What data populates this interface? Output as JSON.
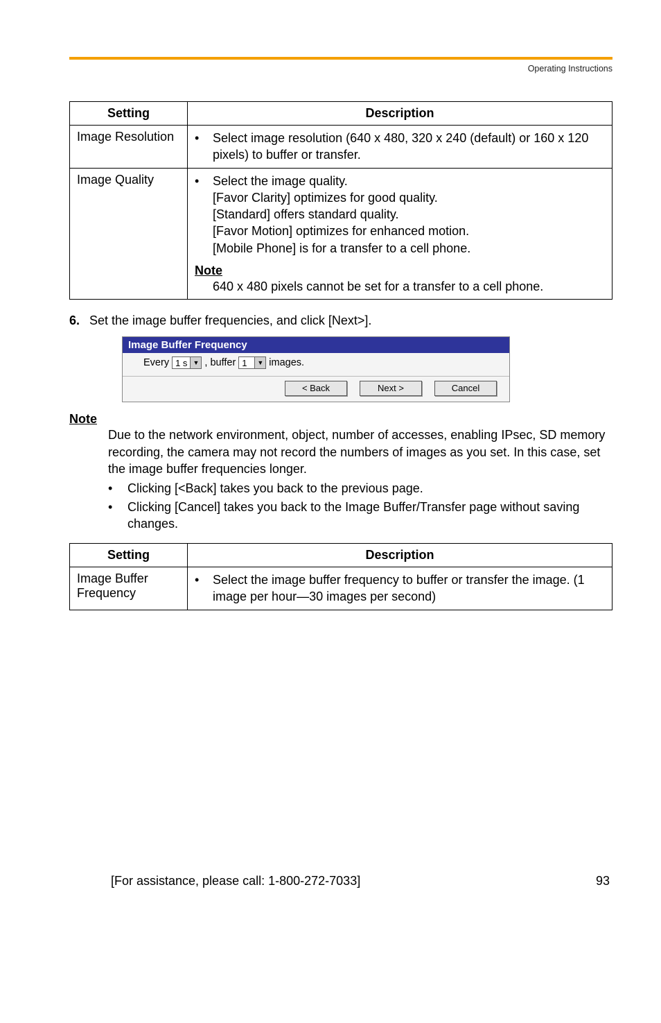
{
  "header": {
    "doc_label": "Operating Instructions"
  },
  "table1": {
    "col_setting": "Setting",
    "col_desc": "Description",
    "rows": [
      {
        "setting": "Image Resolution",
        "bullet": "Select image resolution (640 x 480, 320 x 240 (default) or 160 x 120 pixels) to buffer or transfer."
      },
      {
        "setting": "Image Quality",
        "bullet_lines": [
          "Select the image quality.",
          "[Favor Clarity] optimizes for good quality.",
          "[Standard] offers standard quality.",
          "[Favor Motion] optimizes for enhanced motion.",
          "[Mobile Phone] is for a transfer to a cell phone."
        ],
        "note_label": "Note",
        "note_text": "640 x 480 pixels cannot be set for a transfer to a cell phone."
      }
    ]
  },
  "step6": {
    "num": "6.",
    "text": "Set the image buffer frequencies, and click [Next>]."
  },
  "figure": {
    "title": "Image Buffer Frequency",
    "every_label": "Every",
    "every_value": "1 s",
    "buffer_label": ", buffer",
    "buffer_value": "1",
    "images_label": " images.",
    "btn_back": "< Back",
    "btn_next": "Next >",
    "btn_cancel": "Cancel"
  },
  "note_block": {
    "heading": "Note",
    "para": "Due to the network environment, object, number of accesses, enabling IPsec, SD memory recording, the camera may not record the numbers of images as you set. In this case, set the image buffer frequencies longer.",
    "bullets": [
      "Clicking [<Back] takes you back to the previous page.",
      "Clicking [Cancel] takes you back to the Image Buffer/Transfer page without saving changes."
    ]
  },
  "table2": {
    "col_setting": "Setting",
    "col_desc": "Description",
    "row": {
      "setting": "Image Buffer Frequency",
      "bullet": "Select the image buffer frequency to buffer or transfer the image. (1 image per hour—30 images per second)"
    }
  },
  "footer": {
    "assist": "[For assistance, please call: 1-800-272-7033]",
    "page": "93"
  }
}
